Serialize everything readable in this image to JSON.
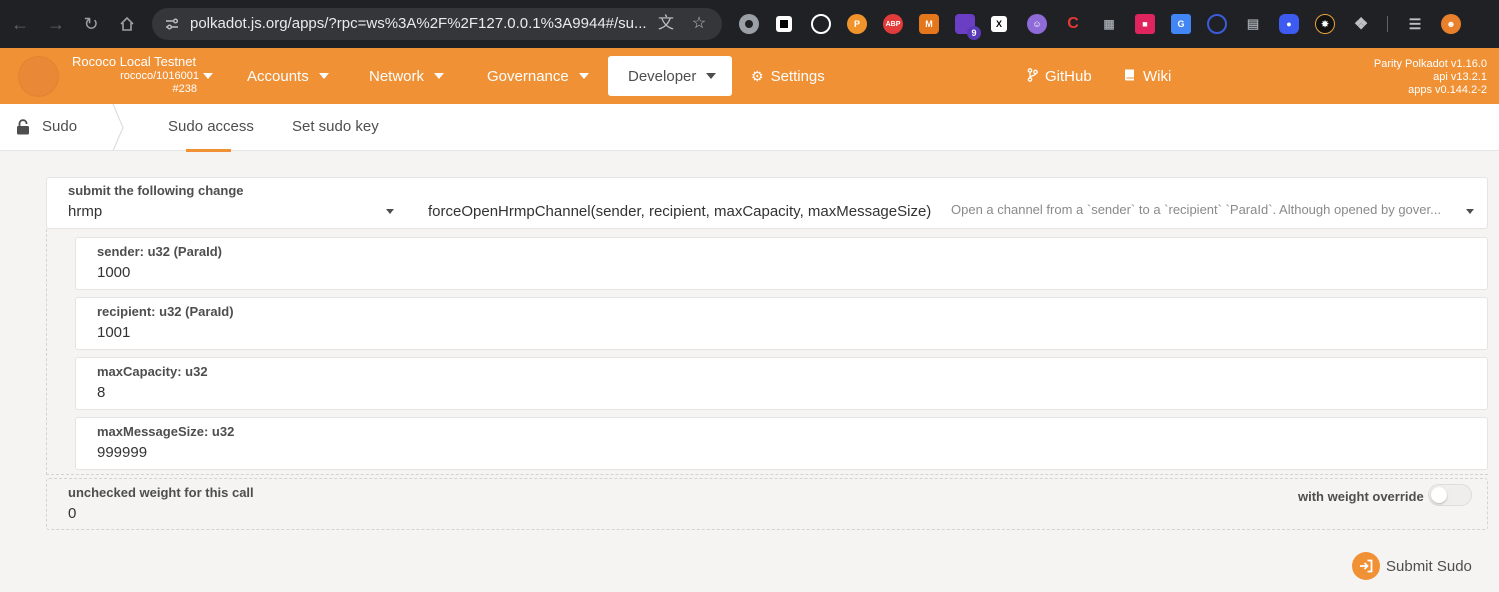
{
  "browser": {
    "url": "polkadot.js.org/apps/?rpc=ws%3A%2F%2F127.0.0.1%3A9944#/su...",
    "extension_badge": "9"
  },
  "header": {
    "chain_name": "Rococo Local Testnet",
    "runtime": "rococo/1016001",
    "block": "#238",
    "menu": {
      "accounts": "Accounts",
      "network": "Network",
      "governance": "Governance",
      "developer": "Developer",
      "settings": "Settings",
      "github": "GitHub",
      "wiki": "Wiki"
    },
    "versions": {
      "node": "Parity Polkadot v1.16.0",
      "api": "api v13.2.1",
      "apps": "apps v0.144.2-2"
    }
  },
  "tabs": {
    "section": "Sudo",
    "items": [
      "Sudo access",
      "Set sudo key"
    ],
    "active": "Sudo access"
  },
  "extrinsic": {
    "label": "submit the following change",
    "module": "hrmp",
    "method": "forceOpenHrmpChannel(sender, recipient, maxCapacity, maxMessageSize)",
    "description": "Open a channel from a `sender` to a `recipient` `ParaId`. Although opened by gover..."
  },
  "params": [
    {
      "label": "sender: u32 (ParaId)",
      "value": "1000"
    },
    {
      "label": "recipient: u32 (ParaId)",
      "value": "1001"
    },
    {
      "label": "maxCapacity: u32",
      "value": "8"
    },
    {
      "label": "maxMessageSize: u32",
      "value": "999999"
    }
  ],
  "weight": {
    "label": "unchecked weight for this call",
    "value": "0",
    "override_label": "with weight override",
    "override_enabled": false
  },
  "submit": {
    "label": "Submit Sudo"
  },
  "colors": {
    "accent": "#f19135",
    "chrome": "#202124",
    "background": "#f5f4f3"
  }
}
